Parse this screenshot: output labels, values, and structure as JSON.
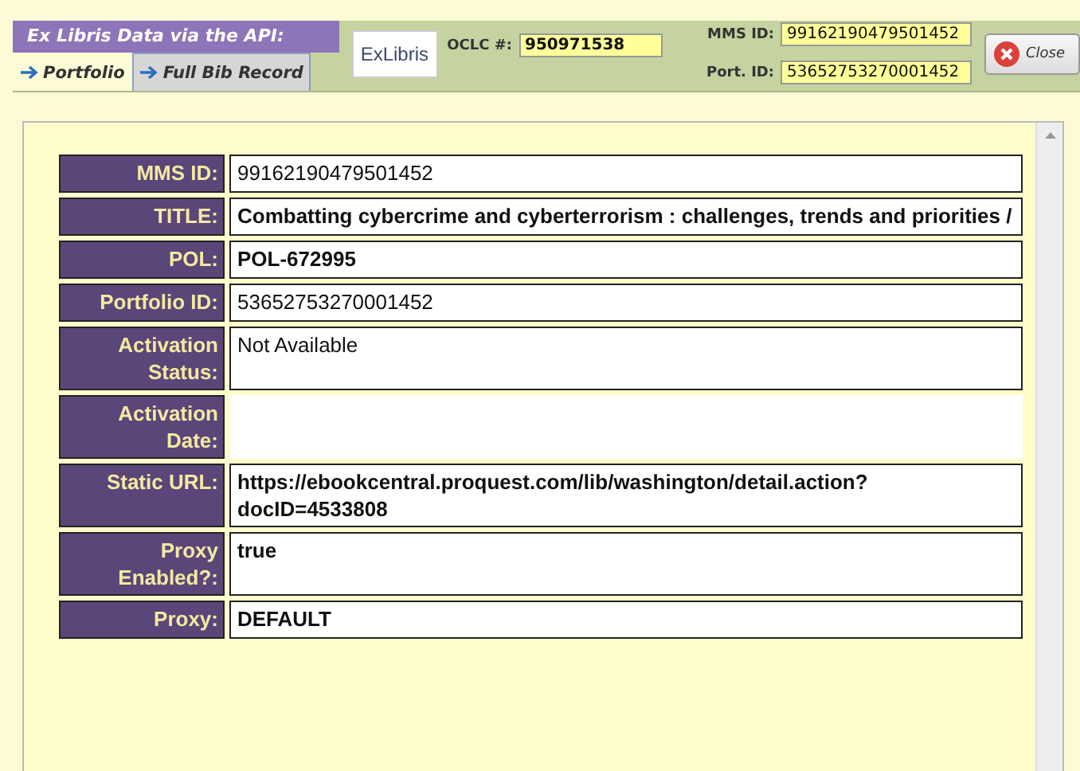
{
  "header": {
    "title": "Ex Libris Data via the API:",
    "logo": "ExLibris",
    "oclc": {
      "label": "OCLC #:",
      "value": "950971538"
    },
    "ids": [
      {
        "label": "MMS ID:",
        "value": "99162190479501452"
      },
      {
        "label": "Port. ID:",
        "value": "53652753270001452"
      }
    ],
    "close": "Close"
  },
  "tabs": [
    {
      "label": "Portfolio",
      "selected": true
    },
    {
      "label": "Full Bib Record",
      "selected": false
    }
  ],
  "rows": [
    {
      "label": "MMS ID:",
      "value": "99162190479501452",
      "bold": false
    },
    {
      "label": "TITLE:",
      "value": "Combatting cybercrime and cyberterrorism : challenges, trends and priorities /",
      "bold": true
    },
    {
      "label": "POL:",
      "value": "POL-672995",
      "bold": true
    },
    {
      "label": "Portfolio ID:",
      "value": "53652753270001452",
      "bold": false
    },
    {
      "label": "Activation Status:",
      "value": "Not Available",
      "bold": false
    },
    {
      "label": "Activation Date:"
    },
    {
      "label": "Static URL:",
      "value": "https://ebookcentral.proquest.com/lib/washington/detail.action?docID=4533808",
      "bold": true
    },
    {
      "label": "Proxy Enabled?:",
      "value": "true",
      "bold": true
    },
    {
      "label": "Proxy:",
      "value": "DEFAULT",
      "bold": true
    }
  ]
}
